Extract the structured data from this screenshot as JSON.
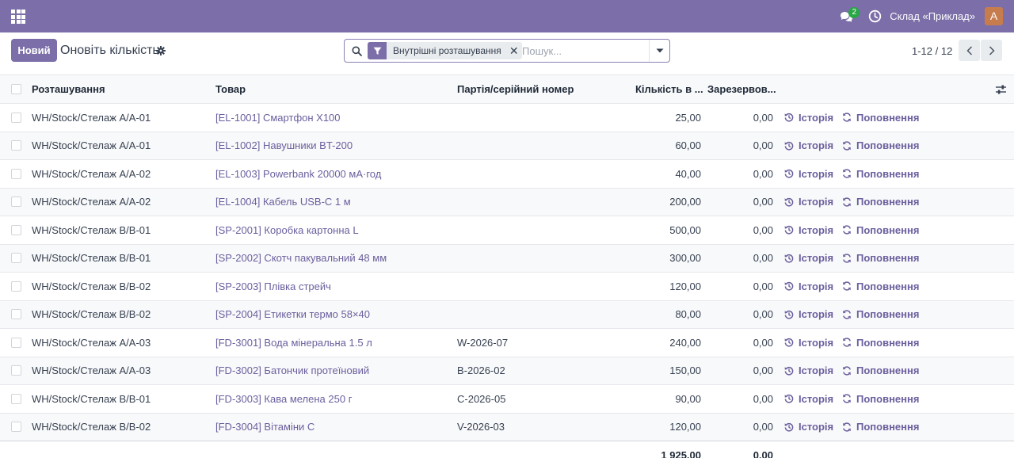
{
  "navbar": {
    "chat_badge": "2",
    "company": "Склад «Приклад»",
    "avatar_letter": "A",
    "accent_color": "#7c6ea8"
  },
  "control_panel": {
    "new_button": "Новий",
    "title": "Оновіть кількість",
    "search": {
      "facet_label": "Внутрішні розташування",
      "placeholder": "Пошук..."
    },
    "pager": {
      "value": "1-12 / 12"
    }
  },
  "table": {
    "columns": {
      "location": "Розташування",
      "product": "Товар",
      "lot": "Партія/серійний номер",
      "quantity": "Кількість в ...",
      "reserved": "Зарезервов..."
    },
    "action_history": "Історія",
    "action_replenish": "Поповнення",
    "rows": [
      {
        "location": "WH/Stock/Стелаж A/A-01",
        "product": "[EL-1001] Смартфон X100",
        "lot": "",
        "quantity": "25,00",
        "reserved": "0,00"
      },
      {
        "location": "WH/Stock/Стелаж A/A-01",
        "product": "[EL-1002] Навушники BT-200",
        "lot": "",
        "quantity": "60,00",
        "reserved": "0,00"
      },
      {
        "location": "WH/Stock/Стелаж A/A-02",
        "product": "[EL-1003] Powerbank 20000 мА·год",
        "lot": "",
        "quantity": "40,00",
        "reserved": "0,00"
      },
      {
        "location": "WH/Stock/Стелаж A/A-02",
        "product": "[EL-1004] Кабель USB-C 1 м",
        "lot": "",
        "quantity": "200,00",
        "reserved": "0,00"
      },
      {
        "location": "WH/Stock/Стелаж B/B-01",
        "product": "[SP-2001] Коробка картонна L",
        "lot": "",
        "quantity": "500,00",
        "reserved": "0,00"
      },
      {
        "location": "WH/Stock/Стелаж B/B-01",
        "product": "[SP-2002] Скотч пакувальний 48 мм",
        "lot": "",
        "quantity": "300,00",
        "reserved": "0,00"
      },
      {
        "location": "WH/Stock/Стелаж B/B-02",
        "product": "[SP-2003] Плівка стрейч",
        "lot": "",
        "quantity": "120,00",
        "reserved": "0,00"
      },
      {
        "location": "WH/Stock/Стелаж B/B-02",
        "product": "[SP-2004] Етикетки термо 58×40",
        "lot": "",
        "quantity": "80,00",
        "reserved": "0,00"
      },
      {
        "location": "WH/Stock/Стелаж A/A-03",
        "product": "[FD-3001] Вода мінеральна 1.5 л",
        "lot": "W-2026-07",
        "quantity": "240,00",
        "reserved": "0,00"
      },
      {
        "location": "WH/Stock/Стелаж A/A-03",
        "product": "[FD-3002] Батончик протеїновий",
        "lot": "B-2026-02",
        "quantity": "150,00",
        "reserved": "0,00"
      },
      {
        "location": "WH/Stock/Стелаж B/B-01",
        "product": "[FD-3003] Кава мелена 250 г",
        "lot": "C-2026-05",
        "quantity": "90,00",
        "reserved": "0,00"
      },
      {
        "location": "WH/Stock/Стелаж B/B-02",
        "product": "[FD-3004] Вітаміни C",
        "lot": "V-2026-03",
        "quantity": "120,00",
        "reserved": "0,00"
      }
    ],
    "totals": {
      "quantity": "1 925,00",
      "reserved": "0,00"
    }
  }
}
